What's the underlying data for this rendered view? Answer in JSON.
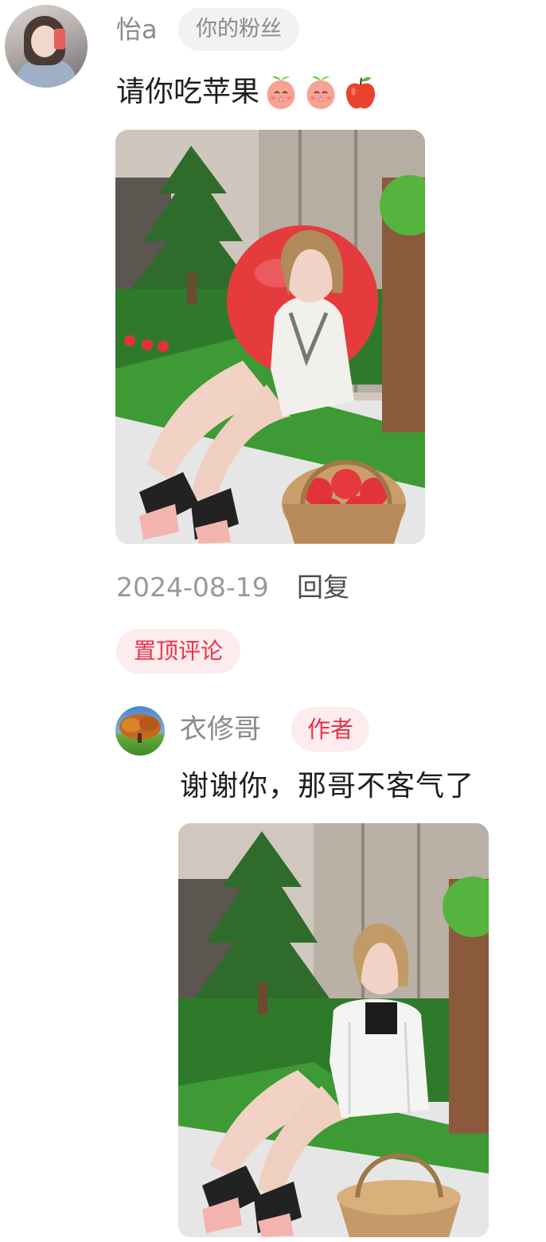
{
  "comment": {
    "username": "怡a",
    "relation_badge": "你的粉丝",
    "text": "请你吃苹果",
    "emojis": [
      "peach-pray-emoji",
      "peach-pray-emoji",
      "apple-emoji"
    ],
    "date": "2024-08-19",
    "reply_label": "回复",
    "pinned_label": "置顶评论"
  },
  "reply": {
    "username": "衣修哥",
    "author_badge": "作者",
    "text": "谢谢你，那哥不客气了"
  },
  "colors": {
    "accent_red": "#e8334a",
    "badge_pink_bg": "#fdeced",
    "muted_text": "#8a8a8a"
  }
}
